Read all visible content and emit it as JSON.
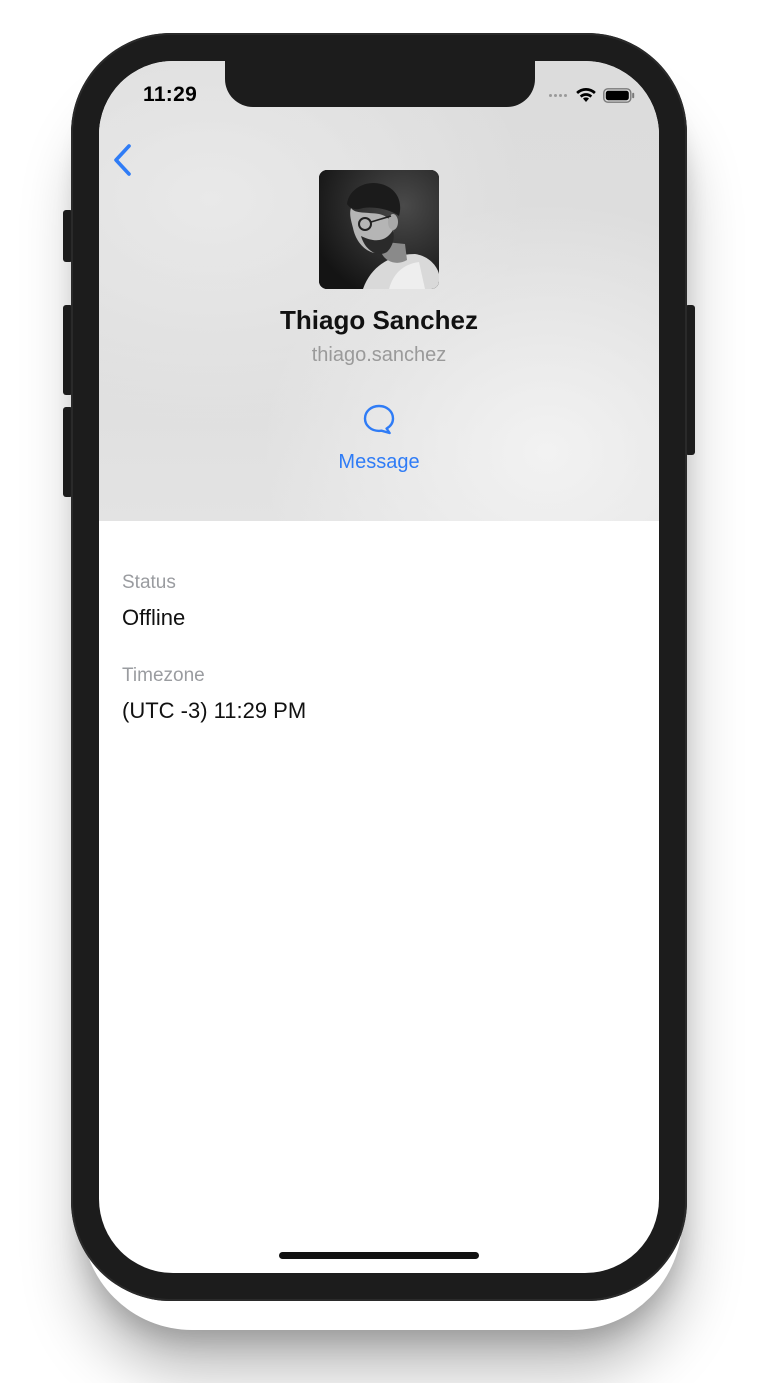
{
  "status_bar": {
    "time": "11:29"
  },
  "navigation": {
    "back_icon": "chevron-left-icon"
  },
  "profile": {
    "name": "Thiago Sanchez",
    "username": "thiago.sanchez"
  },
  "actions": {
    "message_label": "Message",
    "message_icon": "speech-bubble-icon"
  },
  "details": {
    "status_label": "Status",
    "status_value": "Offline",
    "timezone_label": "Timezone",
    "timezone_value": "(UTC -3) 11:29 PM"
  },
  "colors": {
    "accent": "#2f7cf6",
    "label_gray": "#9a9ca0",
    "text": "#111111"
  }
}
